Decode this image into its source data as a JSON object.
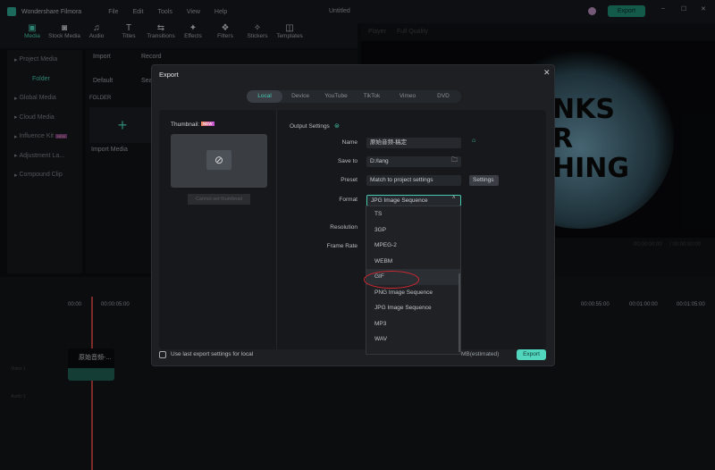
{
  "app": {
    "title": "Wondershare Filmora",
    "project": "Untitled",
    "menu": [
      "File",
      "Edit",
      "Tools",
      "View",
      "Help"
    ],
    "export_label": "Export"
  },
  "toolbar": [
    "Media",
    "Stock Media",
    "Audio",
    "Titles",
    "Transitions",
    "Effects",
    "Filters",
    "Stickers",
    "Templates"
  ],
  "sidebar": {
    "items": [
      "Project Media",
      "Folder",
      "Global Media",
      "Cloud Media",
      "Influence Kit",
      "Adjustment La...",
      "Compound Clip"
    ],
    "new_badge": "NEW"
  },
  "media": {
    "import": "Import",
    "record": "Record",
    "default": "Default",
    "search_placeholder": "Sea",
    "folder_header": "FOLDER",
    "import_media": "Import Media"
  },
  "preview": {
    "player": "Player",
    "quality": "Full Quality",
    "text": [
      "NKS",
      "R",
      "HING"
    ],
    "time": "00:00:00:00",
    "total": "/ 00:00:00:00"
  },
  "timeline": {
    "ticks": [
      "00:00",
      "00:00:05:00",
      "00:00:55:00",
      "00:01:00:00",
      "00:01:05:00"
    ],
    "clip": "原始音频-...",
    "video_track": "Video 1",
    "audio_track": "Audio 1"
  },
  "dialog": {
    "title": "Export",
    "tabs": [
      "Local",
      "Device",
      "YouTube",
      "TikTok",
      "Vimeo",
      "DVD"
    ],
    "thumbnail_label": "Thumbnail:",
    "new_badge": "NEW",
    "cannot_set": "Cannot set thumbnail",
    "output_settings": "Output Settings",
    "name_label": "Name",
    "name_value": "原始音频-稿定",
    "save_label": "Save to",
    "save_value": "D:/lang",
    "preset_label": "Preset",
    "preset_value": "Match to project settings",
    "settings_button": "Settings",
    "format_label": "Format",
    "format_value": "JPG Image Sequence",
    "resolution_label": "Resolution",
    "framerate_label": "Frame Rate",
    "format_options": [
      "TS",
      "3GP",
      "MPEG-2",
      "WEBM",
      "GIF",
      "PNG Image Sequence",
      "JPG Image Sequence",
      "MP3",
      "WAV"
    ],
    "highlighted_option": "GIF",
    "use_last": "Use last export settings for local",
    "size": "MB(estimated)",
    "export_button": "Export"
  },
  "colors": {
    "accent": "#47c9b0",
    "highlight_ring": "#d0282f"
  }
}
